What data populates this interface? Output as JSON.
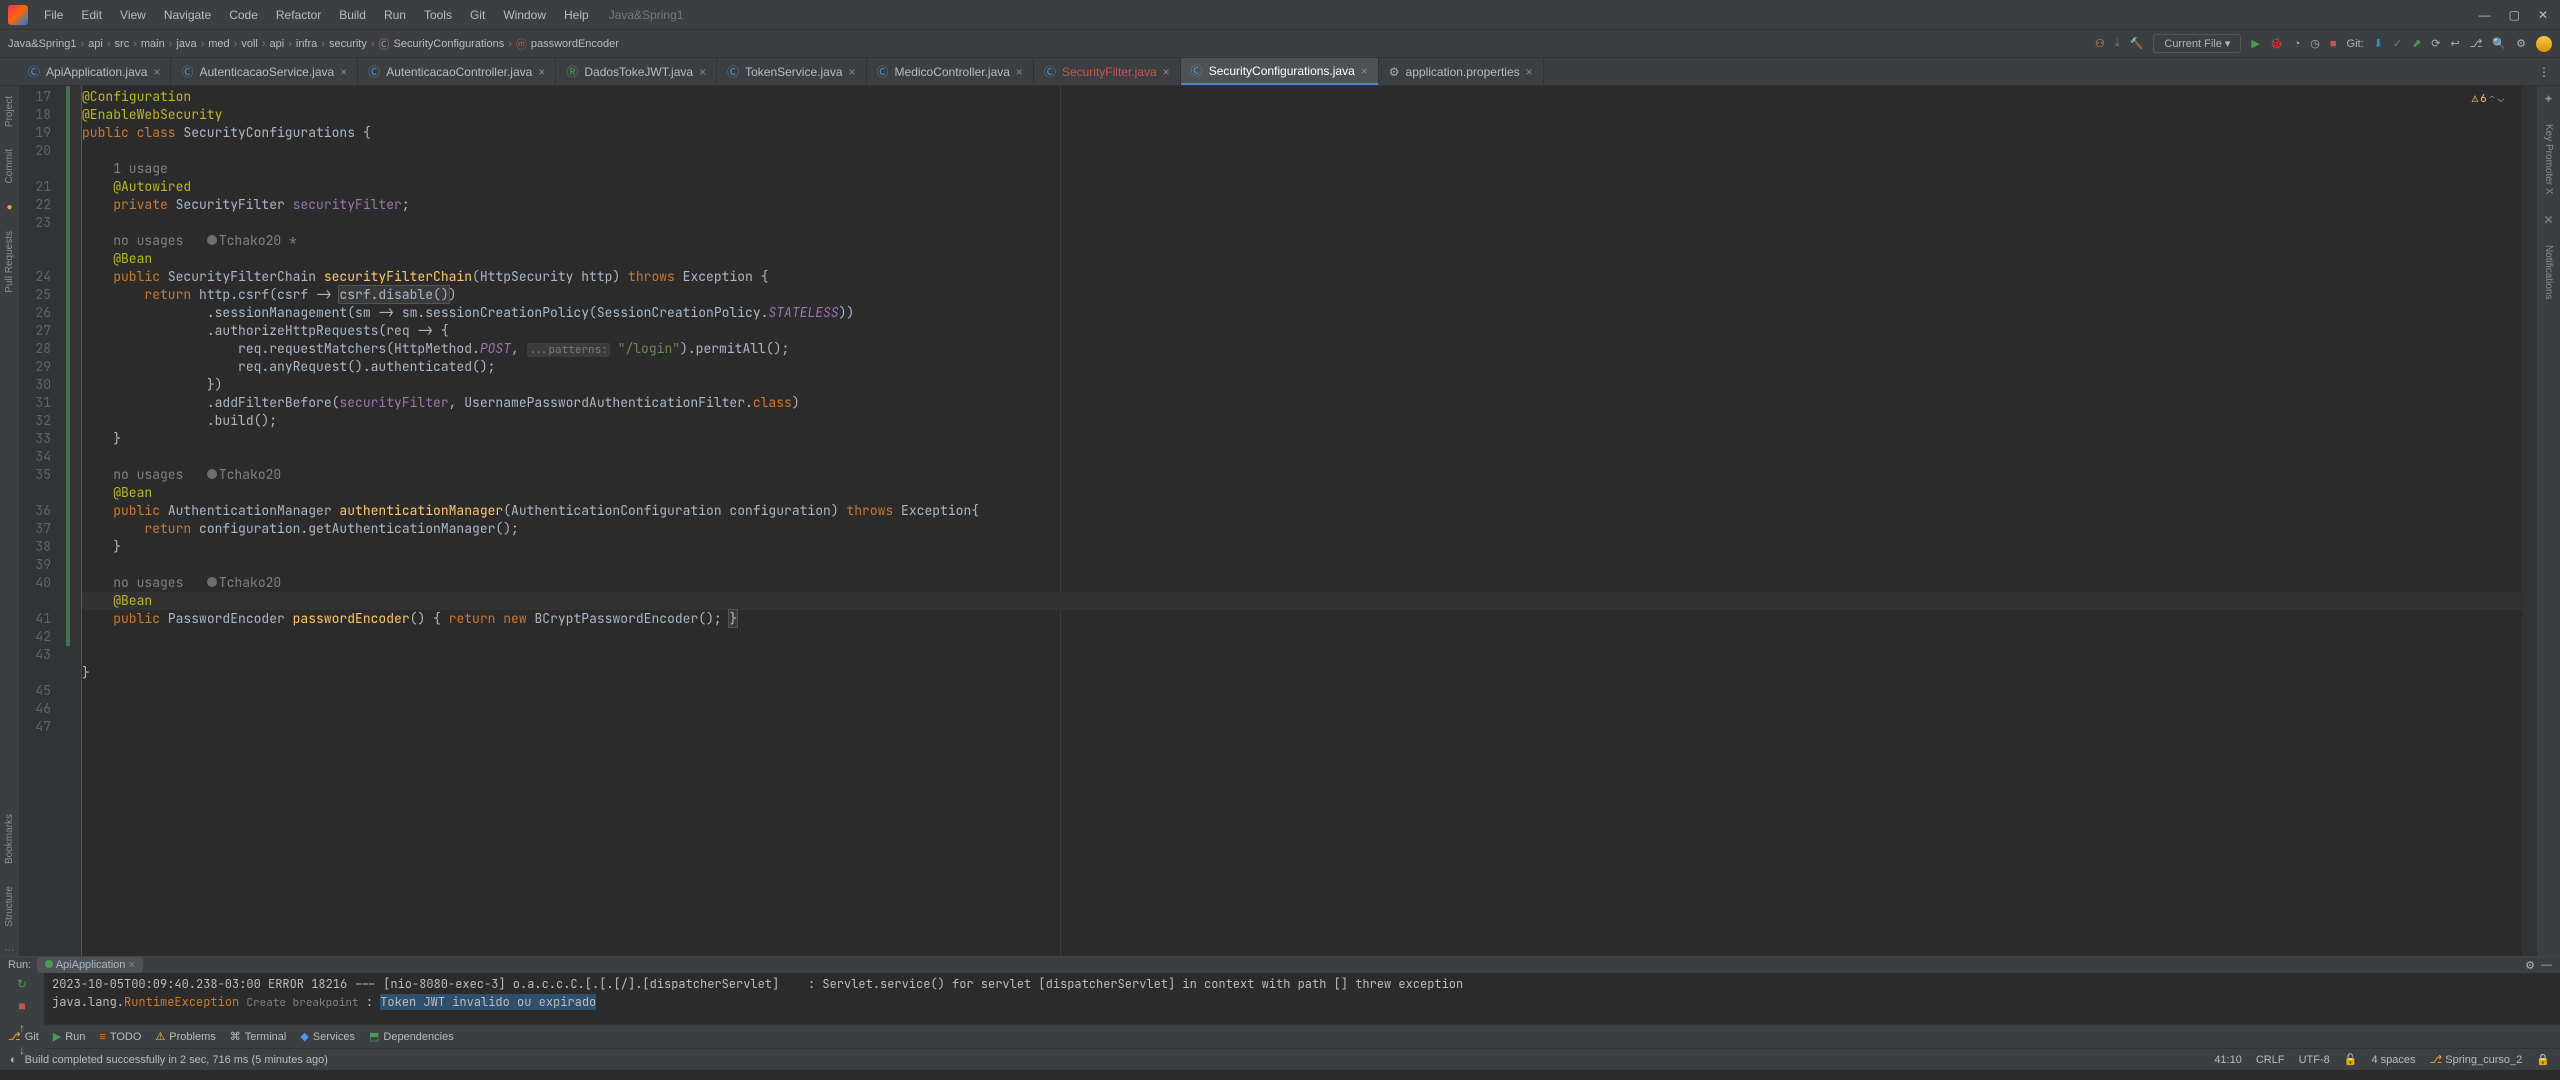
{
  "menu": [
    "File",
    "Edit",
    "View",
    "Navigate",
    "Code",
    "Refactor",
    "Build",
    "Run",
    "Tools",
    "Git",
    "Window",
    "Help"
  ],
  "project_name": "Java&Spring1",
  "breadcrumb": [
    "Java&Spring1",
    "api",
    "src",
    "main",
    "java",
    "med",
    "voll",
    "api",
    "infra",
    "security",
    "SecurityConfigurations",
    "passwordEncoder"
  ],
  "bc_icons": {
    "class": "©",
    "method": "m"
  },
  "run_config": "Current File",
  "toolbar": {
    "git_label": "Git:"
  },
  "tabs": [
    {
      "name": "ApiApplication.java",
      "active": false,
      "icon": "java"
    },
    {
      "name": "AutenticacaoService.java",
      "active": false,
      "icon": "java"
    },
    {
      "name": "AutenticacaoController.java",
      "active": false,
      "icon": "java"
    },
    {
      "name": "DadosTokeJWT.java",
      "active": false,
      "icon": "sec"
    },
    {
      "name": "TokenService.java",
      "active": false,
      "icon": "java"
    },
    {
      "name": "MedicoController.java",
      "active": false,
      "icon": "java"
    },
    {
      "name": "SecurityFilter.java",
      "active": false,
      "icon": "red"
    },
    {
      "name": "SecurityConfigurations.java",
      "active": true,
      "icon": "java"
    },
    {
      "name": "application.properties",
      "active": false,
      "icon": "prop"
    }
  ],
  "left_tools": [
    "Project",
    "Commit",
    "Pull Requests"
  ],
  "left_tools2": [
    "Bookmarks",
    "Structure"
  ],
  "right_tools": [
    "Key Promoter X",
    "Notifications"
  ],
  "warnings": "6",
  "line_start": 17,
  "caret_line": 41,
  "usages": {
    "one": "1 usage",
    "none": "no usages"
  },
  "author1": "Tchako20 *",
  "author2": "Tchako20",
  "code": {
    "l17": "@Configuration",
    "l18": "@EnableWebSecurity",
    "l19a": "public class ",
    "l19b": "SecurityConfigurations ",
    "l19c": "{",
    "l22": "@Autowired",
    "l23a": "private ",
    "l23b": "SecurityFilter ",
    "l23c": "securityFilter",
    "l23d": ";",
    "l25": "@Bean",
    "l26a": "public ",
    "l26b": "SecurityFilterChain ",
    "l26c": "securityFilterChain",
    "l26d": "(HttpSecurity http) ",
    "l26e": "throws ",
    "l26f": "Exception {",
    "l27a": "return ",
    "l27b": "http.csrf(csrf -> ",
    "l27c": "csrf.disable()",
    "l27d": ")",
    "l28a": ".sessionManagement(sm -> sm.sessionCreationPolicy(SessionCreationPolicy.",
    "l28b": "STATELESS",
    "l28c": "))",
    "l29": ".authorizeHttpRequests(req -> {",
    "l30a": "req.requestMatchers(HttpMethod.",
    "l30b": "POST",
    "l30c": ", ",
    "l30hint": "...patterns:",
    "l30d": " \"/login\"",
    "l30e": ").permitAll();",
    "l31": "req.anyRequest().authenticated();",
    "l32": "})",
    "l33a": ".addFilterBefore(",
    "l33b": "securityFilter",
    "l33c": ", UsernamePasswordAuthenticationFilter.",
    "l33d": "class",
    "l33e": ")",
    "l34": ".build();",
    "l35": "}",
    "l37": "@Bean",
    "l38a": "public ",
    "l38b": "AuthenticationManager ",
    "l38c": "authenticationManager",
    "l38d": "(AuthenticationConfiguration configuration) ",
    "l38e": "throws ",
    "l38f": "Exception{",
    "l39a": "return ",
    "l39b": "configuration.getAuthenticationManager();",
    "l40": "}",
    "l42": "@Bean",
    "l43a": "public ",
    "l43b": "PasswordEncoder ",
    "l43c": "passwordEncoder",
    "l43d": "() { ",
    "l43e": "return new ",
    "l43f": "BCryptPasswordEncoder(); ",
    "l43g": "}",
    "l46": "}"
  },
  "run": {
    "title": "Run:",
    "tab": "ApiApplication",
    "log1": "2023-10-05T00:09:40.238-03:00 ERROR 18216 --- [nio-8080-exec-3] o.a.c.c.C.[.[.[/].[dispatcherServlet]    : Servlet.service() for servlet [dispatcherServlet] in context with path [] threw exception",
    "log2a": "java.lang.",
    "log2b": "RuntimeException",
    "log2bp": "Create breakpoint",
    "log2c": " : ",
    "log2d": "Token JWT invalido ou expirado"
  },
  "bottom": {
    "git": "Git",
    "run": "Run",
    "todo": "TODO",
    "problems": "Problems",
    "terminal": "Terminal",
    "services": "Services",
    "deps": "Dependencies"
  },
  "status": {
    "msg": "Build completed successfully in 2 sec, 716 ms (5 minutes ago)",
    "pos": "41:10",
    "sep": "CRLF",
    "enc": "UTF-8",
    "indent": "4 spaces",
    "branch": "Spring_curso_2"
  }
}
